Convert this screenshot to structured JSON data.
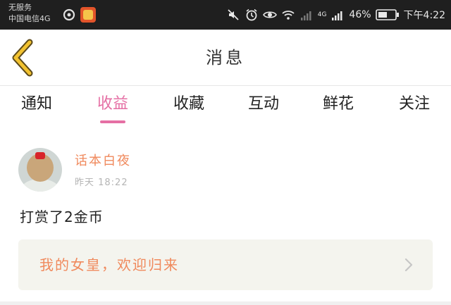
{
  "status_bar": {
    "carrier_line1": "无服务",
    "carrier_line2": "中国电信4G",
    "network": "4G",
    "battery": "46%",
    "time": "下午4:22"
  },
  "header": {
    "title": "消息",
    "back_icon": "chevron-left-icon",
    "accent_color": "#f2c230"
  },
  "tabs": {
    "items": [
      {
        "label": "通知"
      },
      {
        "label": "收益"
      },
      {
        "label": "收藏"
      },
      {
        "label": "互动"
      },
      {
        "label": "鲜花"
      },
      {
        "label": "关注"
      }
    ],
    "active_index": 1,
    "active_color": "#e56fa4"
  },
  "message": {
    "username": "话本白夜",
    "time": "昨天 18:22",
    "content": "打赏了2金币",
    "reply_text": "我的女皇，欢迎归来",
    "name_color": "#f0895c"
  }
}
